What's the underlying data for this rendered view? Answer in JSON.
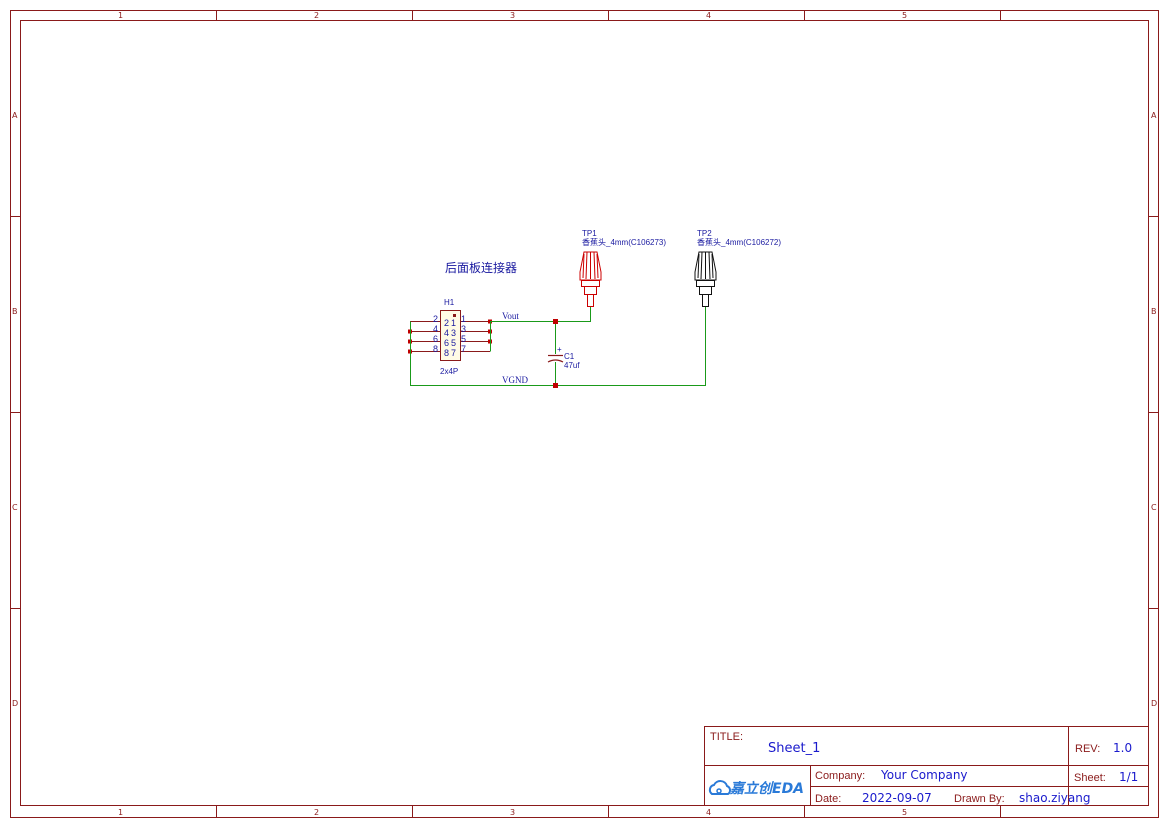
{
  "zones": {
    "columns": [
      "1",
      "2",
      "3",
      "4",
      "5"
    ],
    "rows": [
      "A",
      "B",
      "C",
      "D"
    ]
  },
  "schematic": {
    "block_label": "后面板连接器",
    "h1": {
      "ref": "H1",
      "value": "2x4P",
      "pins_left": [
        "2",
        "4",
        "6",
        "8"
      ],
      "pins_right": [
        "1",
        "3",
        "5",
        "7"
      ],
      "inner_left": [
        "2",
        "4",
        "6",
        "8"
      ],
      "inner_right": [
        "1",
        "3",
        "5",
        "7"
      ]
    },
    "tp1": {
      "ref": "TP1",
      "value": "香蕉头_4mm(C106273)",
      "color": "#cc0000"
    },
    "tp2": {
      "ref": "TP2",
      "value": "香蕉头_4mm(C106272)",
      "color": "#111111"
    },
    "c1": {
      "ref": "C1",
      "value": "47uf",
      "polarity": "+"
    },
    "nets": {
      "vout": "Vout",
      "vgnd": "VGND"
    }
  },
  "title_block": {
    "title_label": "TITLE:",
    "title_value": "Sheet_1",
    "rev_label": "REV:",
    "rev_value": "1.0",
    "company_label": "Company:",
    "company_value": "Your Company",
    "sheet_label": "Sheet:",
    "sheet_value": "1/1",
    "date_label": "Date:",
    "date_value": "2022-09-07",
    "drawn_label": "Drawn By:",
    "drawn_value": "shao.ziyang",
    "logo_text": "嘉立创EDA"
  },
  "colors": {
    "frame": "#8a1a1a",
    "wire": "#1a9a1a",
    "text": "#1a1aa0",
    "junction": "#c00000"
  }
}
